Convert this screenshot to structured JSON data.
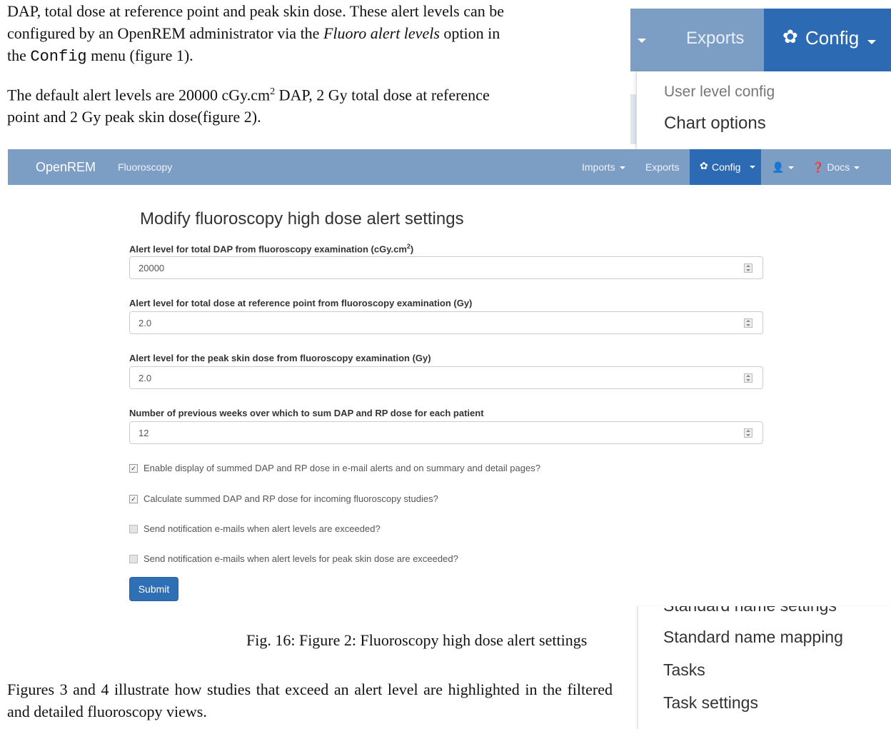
{
  "doc": {
    "top_paragraph_1": [
      "DAP, total dose at reference point and peak skin dose. These alert levels can be",
      "configured by an OpenREM administrator via the ",
      "Fluoro alert levels",
      " option in",
      "the ",
      "Config",
      " menu (figure 1)."
    ],
    "top_paragraph_2_line1_a": "The default alert levels are 20000 cGy.cm",
    "top_paragraph_2_sup": "2",
    "top_paragraph_2_line1_b": " DAP, 2 Gy total dose at reference",
    "top_paragraph_2_line2": "point and 2 Gy peak skin dose(figure 2).",
    "caption": "Fig. 16: Figure 2: Fluoroscopy high dose alert settings",
    "bottom_paragraph": "Figures 3 and 4 illustrate how studies that exceed an alert level are highlighted in the filtered and detailed fluoroscopy views."
  },
  "figure1": {
    "exports": "Exports",
    "config": "Config",
    "menu_items": [
      "User level config",
      "Chart options"
    ]
  },
  "navbar": {
    "brand": "OpenREM",
    "section": "Fluoroscopy",
    "imports": "Imports",
    "exports": "Exports",
    "config": "Config",
    "docs": "Docs"
  },
  "form": {
    "heading": "Modify fluoroscopy high dose alert settings",
    "dap_label_a": "Alert level for total DAP from fluoroscopy examination (cGy.cm",
    "dap_label_sup": "2",
    "dap_label_b": ")",
    "dap_value": "20000",
    "rp_label": "Alert level for total dose at reference point from fluoroscopy examination (Gy)",
    "rp_value": "2.0",
    "skin_label": "Alert level for the peak skin dose from fluoroscopy examination (Gy)",
    "skin_value": "2.0",
    "weeks_label": "Number of previous weeks over which to sum DAP and RP dose for each patient",
    "weeks_value": "12",
    "check1": "Enable display of summed DAP and RP dose in e-mail alerts and on summary and detail pages?",
    "check1_checked": true,
    "check2": "Calculate summed DAP and RP dose for incoming fluoroscopy studies?",
    "check2_checked": true,
    "check3": "Send notification e-mails when alert levels are exceeded?",
    "check3_checked": false,
    "check4": "Send notification e-mails when alert levels for peak skin dose are exceeded?",
    "check4_checked": false,
    "submit": "Submit"
  },
  "figure2": {
    "cut_item": "Standard name settings",
    "menu_items": [
      "Standard name mapping",
      "Tasks",
      "Task settings"
    ]
  }
}
